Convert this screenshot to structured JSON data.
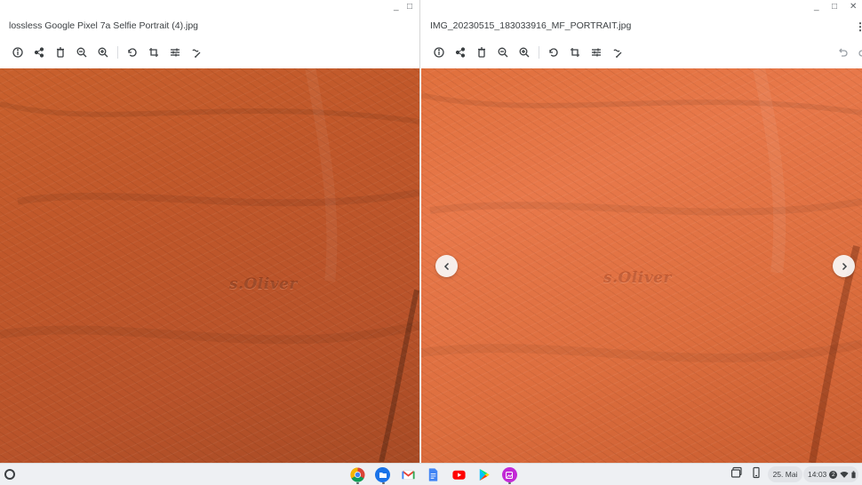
{
  "left_window": {
    "title": "lossless Google Pixel 7a Selfie Portrait (4).jpg",
    "controls": {
      "minimize": "_",
      "maximize": "□"
    },
    "toolbar": [
      "info-icon",
      "share-icon",
      "delete-icon",
      "zoom-out-icon",
      "zoom-in-icon",
      "rotate-icon",
      "crop-icon",
      "adjust-icon",
      "annotate-icon"
    ],
    "photo_text": "s.Oliver"
  },
  "right_window": {
    "title": "IMG_20230515_183033916_MF_PORTRAIT.jpg",
    "controls": {
      "minimize": "_",
      "maximize": "□",
      "close": "✕"
    },
    "toolbar": [
      "info-icon",
      "share-icon",
      "delete-icon",
      "zoom-out-icon",
      "zoom-in-icon",
      "rotate-icon",
      "crop-icon",
      "adjust-icon",
      "annotate-icon"
    ],
    "photo_text": "s.Oliver",
    "kebab": "⋮"
  },
  "left_kebab": "⋮",
  "shelf": {
    "apps": [
      "chrome-icon",
      "files-icon",
      "gmail-icon",
      "docs-icon",
      "youtube-icon",
      "play-store-icon",
      "gallery-icon"
    ],
    "date": "25. Mai",
    "time": "14:03",
    "notification_count": "2"
  },
  "colors": {
    "shirt_left": "#c0572a",
    "shirt_right": "#e0703d",
    "shelf": "#eef0f3"
  }
}
